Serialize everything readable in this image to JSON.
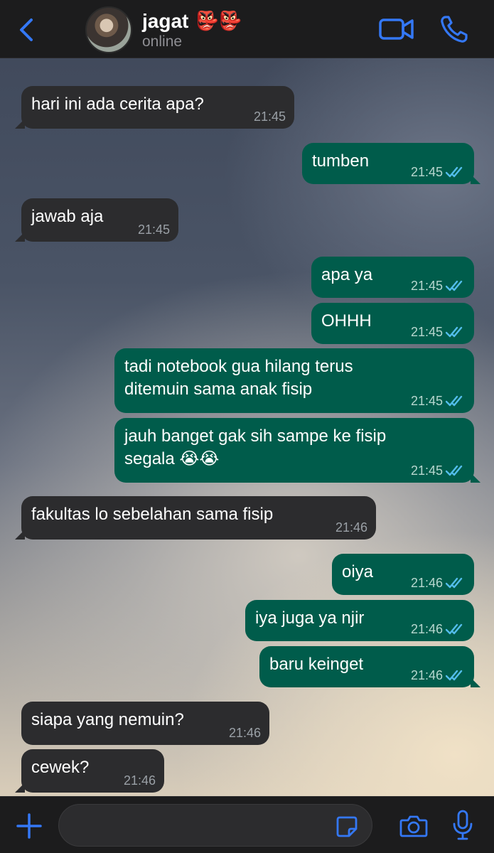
{
  "header": {
    "back_icon": "chevron-left-icon",
    "contact_name": "jagat",
    "name_emoji": "👺👺",
    "status": "online",
    "video_icon": "video-camera-icon",
    "call_icon": "phone-icon",
    "accent_color": "#3478f6"
  },
  "messages": [
    {
      "direction": "in",
      "text": "hari ini ada cerita apa?",
      "time": "21:45"
    },
    {
      "direction": "out",
      "text": "tumben",
      "time": "21:45",
      "read": true
    },
    {
      "direction": "in",
      "text": "jawab aja",
      "time": "21:45"
    },
    {
      "direction": "out",
      "text": "apa ya",
      "time": "21:45",
      "read": true
    },
    {
      "direction": "out",
      "text": "OHHH",
      "time": "21:45",
      "read": true
    },
    {
      "direction": "out",
      "text": "tadi notebook gua hilang terus\nditemuin sama anak fisip",
      "time": "21:45",
      "read": true
    },
    {
      "direction": "out",
      "text": "jauh banget gak sih sampe ke fisip\nsegala 😭😭",
      "time": "21:45",
      "read": true
    },
    {
      "direction": "in",
      "text": "fakultas lo sebelahan sama fisip",
      "time": "21:46"
    },
    {
      "direction": "out",
      "text": "oiya",
      "time": "21:46",
      "read": true
    },
    {
      "direction": "out",
      "text": "iya juga ya njir",
      "time": "21:46",
      "read": true
    },
    {
      "direction": "out",
      "text": "baru keinget",
      "time": "21:46",
      "read": true
    },
    {
      "direction": "in",
      "text": "siapa yang nemuin?",
      "time": "21:46"
    },
    {
      "direction": "in",
      "text": "cewek?",
      "time": "21:46"
    }
  ],
  "colors": {
    "incoming_bubble": "#2c2c2e",
    "outgoing_bubble": "#005c4b",
    "read_tick": "#53bdeb"
  },
  "composer": {
    "plus_icon": "plus-icon",
    "input_value": "",
    "sticker_icon": "sticker-icon",
    "camera_icon": "camera-icon",
    "mic_icon": "microphone-icon"
  }
}
